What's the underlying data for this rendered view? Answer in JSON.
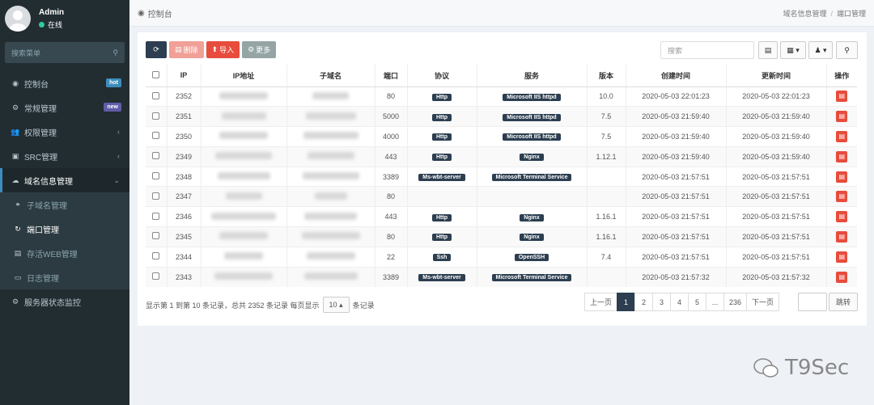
{
  "user": {
    "name": "Admin",
    "status": "在线"
  },
  "sidebar": {
    "search_placeholder": "搜索菜单",
    "items": [
      {
        "label": "控制台",
        "icon": "dashboard-icon",
        "badge": "hot",
        "badge_color": "#3c8dbc"
      },
      {
        "label": "常规管理",
        "icon": "cogs-icon",
        "badge": "new",
        "badge_color": "#605ca8"
      },
      {
        "label": "权限管理",
        "icon": "users-icon",
        "chevron": "‹"
      },
      {
        "label": "SRC管理",
        "icon": "card-icon",
        "chevron": "‹"
      },
      {
        "label": "域名信息管理",
        "icon": "cloud-icon",
        "chevron": "⌄"
      }
    ],
    "subitems": [
      {
        "label": "子域名管理",
        "icon": "link-icon"
      },
      {
        "label": "端口管理",
        "icon": "refresh-icon"
      },
      {
        "label": "存活WEB管理",
        "icon": "file-icon"
      },
      {
        "label": "日志管理",
        "icon": "monitor-icon"
      }
    ],
    "last_item": {
      "label": "服务器状态监控",
      "icon": "cogs-icon"
    }
  },
  "breadcrumb": {
    "home": "控制台",
    "trail": [
      "域名信息管理",
      "端口管理"
    ]
  },
  "toolbar": {
    "delete": "删除",
    "import": "导入",
    "more": "更多",
    "search_placeholder": "搜索"
  },
  "table": {
    "headers": [
      "IP",
      "IP地址",
      "子域名",
      "端口",
      "协议",
      "服务",
      "版本",
      "创建时间",
      "更新时间",
      "操作"
    ],
    "rows": [
      {
        "id": "2352",
        "port": "80",
        "protocol": "Http",
        "service": "Microsoft IIS httpd",
        "version": "10.0",
        "created": "2020-05-03 22:01:23",
        "updated": "2020-05-03 22:01:23"
      },
      {
        "id": "2351",
        "port": "5000",
        "protocol": "Http",
        "service": "Microsoft IIS httpd",
        "version": "7.5",
        "created": "2020-05-03 21:59:40",
        "updated": "2020-05-03 21:59:40"
      },
      {
        "id": "2350",
        "port": "4000",
        "protocol": "Http",
        "service": "Microsoft IIS httpd",
        "version": "7.5",
        "created": "2020-05-03 21:59:40",
        "updated": "2020-05-03 21:59:40"
      },
      {
        "id": "2349",
        "port": "443",
        "protocol": "Http",
        "service": "Nginx",
        "version": "1.12.1",
        "created": "2020-05-03 21:59:40",
        "updated": "2020-05-03 21:59:40"
      },
      {
        "id": "2348",
        "port": "3389",
        "protocol": "Ms-wbt-server",
        "service": "Microsoft Terminal Service",
        "version": "",
        "created": "2020-05-03 21:57:51",
        "updated": "2020-05-03 21:57:51"
      },
      {
        "id": "2347",
        "port": "80",
        "protocol": "",
        "service": "",
        "version": "",
        "created": "2020-05-03 21:57:51",
        "updated": "2020-05-03 21:57:51"
      },
      {
        "id": "2346",
        "port": "443",
        "protocol": "Http",
        "service": "Nginx",
        "version": "1.16.1",
        "created": "2020-05-03 21:57:51",
        "updated": "2020-05-03 21:57:51"
      },
      {
        "id": "2345",
        "port": "80",
        "protocol": "Http",
        "service": "Nginx",
        "version": "1.16.1",
        "created": "2020-05-03 21:57:51",
        "updated": "2020-05-03 21:57:51"
      },
      {
        "id": "2344",
        "port": "22",
        "protocol": "Ssh",
        "service": "OpenSSH",
        "version": "7.4",
        "created": "2020-05-03 21:57:51",
        "updated": "2020-05-03 21:57:51"
      },
      {
        "id": "2343",
        "port": "3389",
        "protocol": "Ms-wbt-server",
        "service": "Microsoft Terminal Service",
        "version": "",
        "created": "2020-05-03 21:57:32",
        "updated": "2020-05-03 21:57:32"
      }
    ]
  },
  "footer": {
    "info": "显示第 1 到第 10 条记录，总共 2352 条记录 每页显示",
    "page_size": "10",
    "suffix": "条记录"
  },
  "pagination": {
    "prev": "上一页",
    "pages": [
      "1",
      "2",
      "3",
      "4",
      "5",
      "...",
      "236"
    ],
    "next": "下一页",
    "jump": "跳转"
  },
  "watermark": "T9Sec"
}
